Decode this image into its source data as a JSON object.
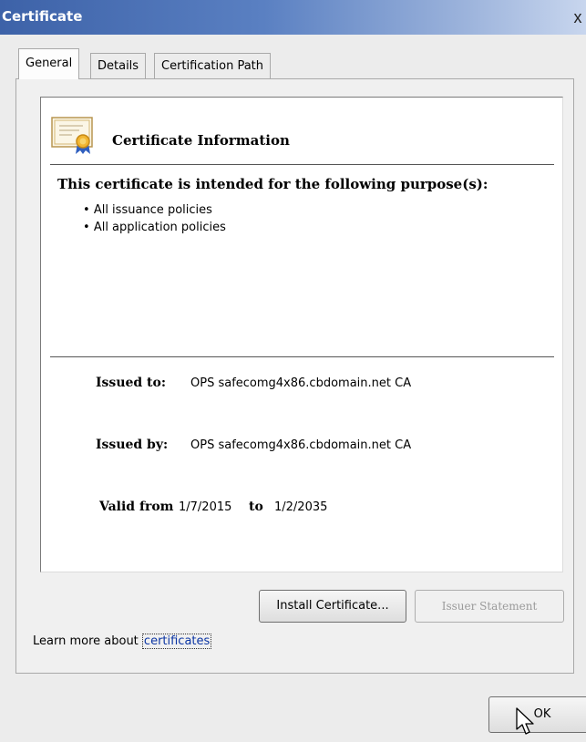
{
  "window": {
    "title": "Certificate",
    "close_glyph": "x"
  },
  "tabs": [
    {
      "label": "General",
      "active": true
    },
    {
      "label": "Details",
      "active": false
    },
    {
      "label": "Certification Path",
      "active": false
    }
  ],
  "info": {
    "icon": "certificate-icon",
    "heading": "Certificate Information",
    "purpose_title": "This certificate is intended for the following purpose(s):",
    "purposes": [
      "All issuance policies",
      "All application policies"
    ],
    "issued_to_label": "Issued to:",
    "issued_to_value": "OPS safecomg4x86.cbdomain.net CA",
    "issued_by_label": "Issued by:",
    "issued_by_value": "OPS safecomg4x86.cbdomain.net CA",
    "valid_from_label": "Valid from",
    "valid_from_value": "1/7/2015",
    "valid_to_label": "to",
    "valid_to_value": "1/2/2035"
  },
  "buttons": {
    "install": "Install Certificate...",
    "issuer_statement": "Issuer Statement",
    "ok": "OK"
  },
  "learn_more": {
    "prefix": "Learn more about",
    "link": "certificates"
  },
  "colors": {
    "title_bar": "#3d62a8",
    "link": "#0b35a3"
  }
}
